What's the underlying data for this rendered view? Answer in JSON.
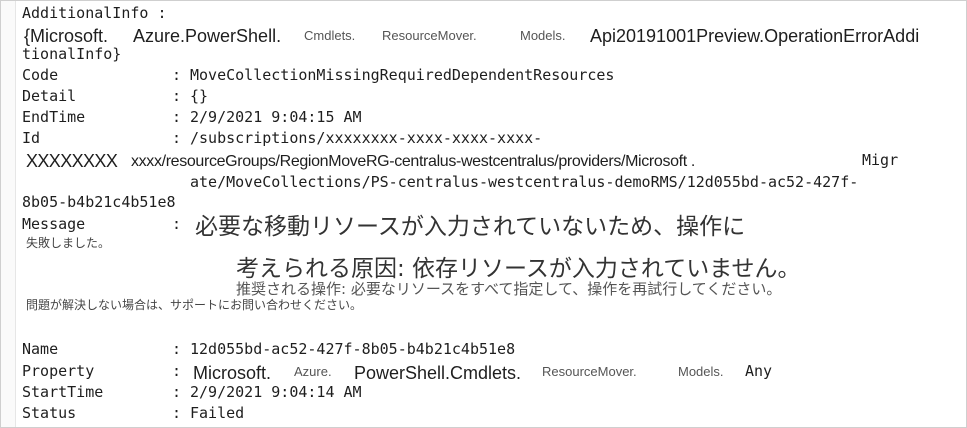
{
  "output": {
    "additional_info_label": "AdditionalInfo :",
    "additional_info_value": {
      "p1": "{Microsoft.",
      "p2": "Azure.PowerShell.",
      "p3": "Cmdlets.",
      "p4": "ResourceMover.",
      "p5": "Models.",
      "p6": "Api20191001Preview.OperationErrorAddi",
      "p7": "tionalInfo}"
    },
    "code_label": "Code",
    "code_value": "MoveCollectionMissingRequiredDependentResources",
    "detail_label": "Detail",
    "detail_value": "{}",
    "endtime_label": "EndTime",
    "endtime_value": "2/9/2021 9:04:15 AM",
    "id_label": "Id",
    "id_value": {
      "l1": "/subscriptions/xxxxxxxx-xxxx-xxxx-xxxx-",
      "l2a": "XXXXXXXX",
      "l2b": "xxxx/resourceGroups/RegionMoveRG-centralus-westcentralus/providers/Microsoft .",
      "l2c": "Migr",
      "l3": "ate/MoveCollections/PS-centralus-westcentralus-demoRMS/12d055bd-ac52-427f-",
      "l4": "8b05-b4b21c4b51e8"
    },
    "message_label": "Message",
    "message_value": {
      "l1": "必要な移動リソースが入力されていないため、操作に",
      "l2": "失敗しました。",
      "l3": "考えられる原因: 依存リソースが入力されていません。",
      "l4": "推奨される操作: 必要なリソースをすべて指定して、操作を再試行してください。",
      "l5": "問題が解決しない場合は、サポートにお問い合わせください。"
    },
    "name_label": "Name",
    "name_value": "12d055bd-ac52-427f-8b05-b4b21c4b51e8",
    "property_label": "Property",
    "property_value": {
      "p1": "Microsoft.",
      "p2": "Azure.",
      "p3": "PowerShell.Cmdlets.",
      "p4": "ResourceMover.",
      "p5": "Models.",
      "p6": "Any"
    },
    "starttime_label": "StartTime",
    "starttime_value": "2/9/2021 9:04:14 AM",
    "status_label": "Status",
    "status_value": "Failed",
    "separator": ":"
  }
}
